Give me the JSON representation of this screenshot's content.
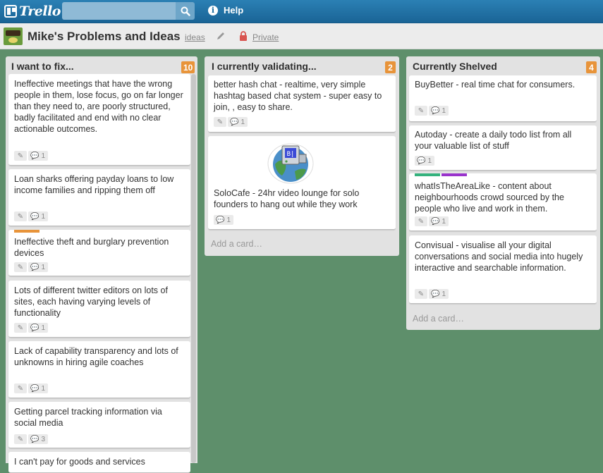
{
  "header": {
    "logo": "Trello",
    "search_placeholder": "",
    "help_label": "Help",
    "colors": {
      "bar": "#1c6ea0",
      "search": "#8fbad6"
    }
  },
  "board": {
    "title": "Mike's Problems and Ideas",
    "org_link": "ideas",
    "visibility": "Private",
    "background": "#5e8f6b"
  },
  "lists": [
    {
      "title": "I want to fix...",
      "count": "10",
      "cards": [
        {
          "text": "Ineffective meetings that have the wrong people in them, lose focus, go on far longer than they need to, are poorly structured, badly facilitated and end with no clear actionable outcomes.",
          "comments": "1"
        },
        {
          "text": "Loan sharks offering payday loans to low income families and ripping them off",
          "comments": "1"
        },
        {
          "text": "Ineffective theft and burglary prevention devices",
          "comments": "1",
          "label_color": "#e8943a"
        },
        {
          "text": "Lots of different twitter editors on lots of sites, each having varying levels of functionality",
          "comments": "1"
        },
        {
          "text": "Lack of capability transparency and lots of unknowns in hiring agile coaches",
          "comments": "1"
        },
        {
          "text": "Getting parcel tracking information via social media",
          "comments": "3"
        },
        {
          "text": "I can't pay for goods and services",
          "comments": ""
        }
      ]
    },
    {
      "title": "I currently validating...",
      "count": "2",
      "cards": [
        {
          "text": "better hash chat - realtime, very simple hashtag based chat system - super easy to join, , easy to share.",
          "comments": "1"
        },
        {
          "text": "SoloCafe - 24hr video lounge for solo founders to hang out while they work",
          "comments": "1",
          "sticker_text": "B|"
        }
      ],
      "add_card": "Add a card…"
    },
    {
      "title": "Currently Shelved",
      "count": "4",
      "cards": [
        {
          "text": "BuyBetter - real time chat for consumers.",
          "comments": "1"
        },
        {
          "text": "Autoday - create a daily todo list from all your valuable list of stuff",
          "comments": "1"
        },
        {
          "text": "whatIsTheAreaLike - content about neighbourhoods crowd sourced by the people who live and work in them.",
          "comments": "1",
          "label_colors": [
            "#34b27d",
            "#9933cc"
          ]
        },
        {
          "text": "Convisual - visualise all your digital conversations and social media into hugely interactive and searchable information.",
          "comments": "1"
        }
      ],
      "add_card": "Add a card…"
    }
  ]
}
